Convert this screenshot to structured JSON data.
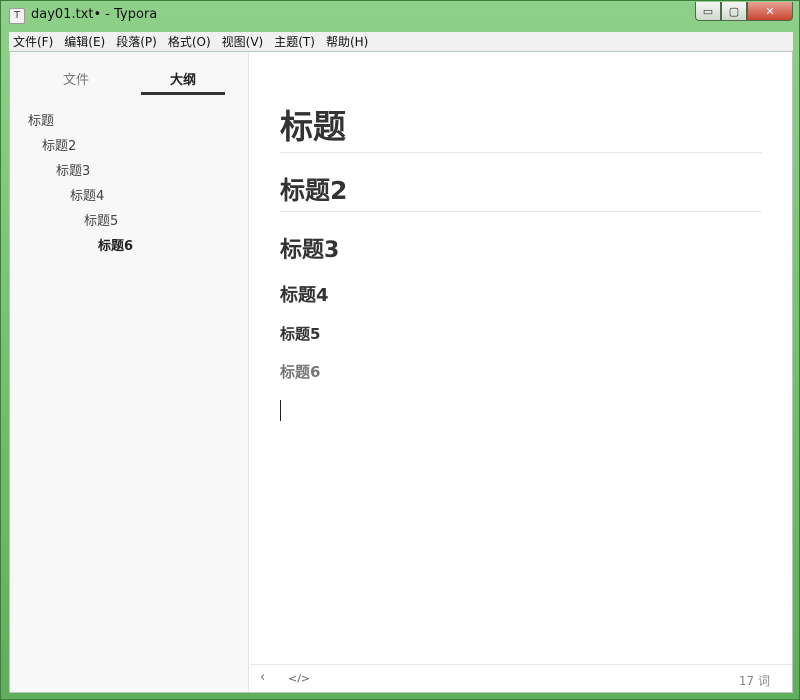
{
  "window": {
    "title": "day01.txt• - Typora",
    "app_icon": "T",
    "controls": {
      "minimize": "▭",
      "maximize": "▢",
      "close": "✕"
    }
  },
  "menu": [
    "文件(F)",
    "编辑(E)",
    "段落(P)",
    "格式(O)",
    "视图(V)",
    "主题(T)",
    "帮助(H)"
  ],
  "sidebar": {
    "tabs": {
      "files": "文件",
      "outline": "大纲"
    },
    "outline": [
      {
        "label": "标题",
        "level": 1
      },
      {
        "label": "标题2",
        "level": 2
      },
      {
        "label": "标题3",
        "level": 3
      },
      {
        "label": "标题4",
        "level": 4
      },
      {
        "label": "标题5",
        "level": 5
      },
      {
        "label": "标题6",
        "level": 6
      }
    ]
  },
  "editor": {
    "h1": "标题",
    "h2": "标题2",
    "h3": "标题3",
    "h4": "标题4",
    "h5": "标题5",
    "h6": "标题6"
  },
  "footer": {
    "back_icon": "‹",
    "source_icon": "</>",
    "word_count": "17 词"
  }
}
